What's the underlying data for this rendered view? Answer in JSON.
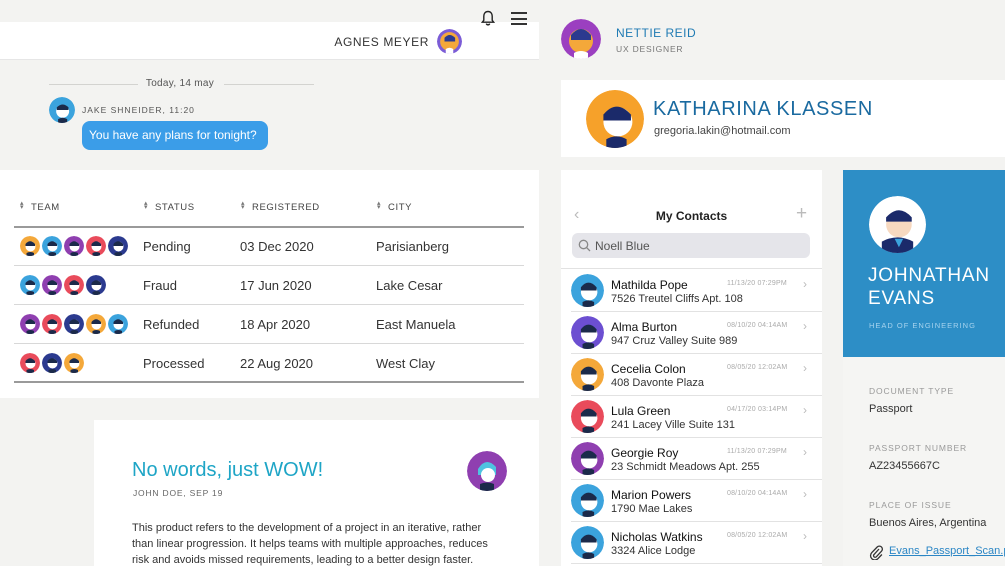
{
  "header": {
    "user_name": "AGNES MEYER"
  },
  "chat": {
    "date": "Today, 14 may",
    "sender": "JAKE SHNEIDER, 11:20",
    "message": "You have any plans for tonight?"
  },
  "table": {
    "columns": [
      "TEAM",
      "STATUS",
      "REGISTERED",
      "CITY"
    ],
    "rows": [
      {
        "status": "Pending",
        "registered": "03 Dec 2020",
        "city": "Parisianberg"
      },
      {
        "status": "Fraud",
        "registered": "17 Jun 2020",
        "city": "Lake Cesar"
      },
      {
        "status": "Refunded",
        "registered": "18 Apr 2020",
        "city": "East Manuela"
      },
      {
        "status": "Processed",
        "registered": "22 Aug 2020",
        "city": "West Clay"
      }
    ]
  },
  "article": {
    "title": "No words, just WOW!",
    "meta": "JOHN DOE, SEP 19",
    "body": "This product refers to the development of a project in an iterative, rather than linear progression. It helps teams with multiple approaches, reduces risk and avoids missed requirements, leading to a better design faster."
  },
  "profile_small": {
    "name": "NETTIE REID",
    "role": "UX DESIGNER"
  },
  "profile_card": {
    "name": "KATHARINA KLASSEN",
    "email": "gregoria.lakin@hotmail.com"
  },
  "contacts": {
    "title": "My Contacts",
    "search_value": "Noell Blue",
    "items": [
      {
        "name": "Mathilda Pope",
        "address": "7526 Treutel Cliffs Apt. 108",
        "time": "11/13/20 07:29PM"
      },
      {
        "name": "Alma Burton",
        "address": "947 Cruz Valley Suite 989",
        "time": "08/10/20 04:14AM"
      },
      {
        "name": "Cecelia Colon",
        "address": "408 Davonte Plaza",
        "time": "08/05/20 12:02AM"
      },
      {
        "name": "Lula Green",
        "address": "241 Lacey Ville Suite 131",
        "time": "04/17/20 03:14PM"
      },
      {
        "name": "Georgie Roy",
        "address": "23 Schmidt Meadows Apt. 255",
        "time": "11/13/20 07:29PM"
      },
      {
        "name": "Marion Powers",
        "address": "1790 Mae Lakes",
        "time": "08/10/20 04:14AM"
      },
      {
        "name": "Nicholas Watkins",
        "address": "3324 Alice Lodge",
        "time": "08/05/20 12:02AM"
      }
    ]
  },
  "person_card": {
    "first_name": "JOHNATHAN",
    "last_name": "EVANS",
    "role": "HEAD OF ENGINEERING",
    "document_type_label": "DOCUMENT TYPE",
    "document_type": "Passport",
    "passport_number_label": "PASSPORT NUMBER",
    "passport_number": "AZ23455667C",
    "place_label": "PLACE OF ISSUE",
    "place": "Buenos Aires, Argentina",
    "attachment": "Evans_Passport_Scan.pdf"
  },
  "colors": {
    "accent": "#3b9de8",
    "brand_blue": "#2d8ec6",
    "title_teal": "#1ea5c6"
  }
}
